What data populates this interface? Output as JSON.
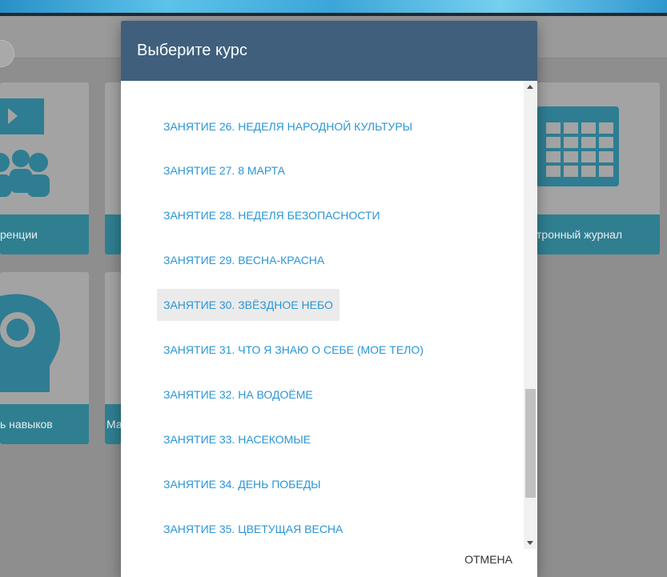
{
  "background_tiles": [
    {
      "label": "ренции"
    },
    {
      "label": ""
    },
    {
      "label": "тронный журнал"
    },
    {
      "label": "ь навыков"
    },
    {
      "label": "Ма"
    }
  ],
  "modal": {
    "title": "Выберите курс",
    "items": [
      {
        "label": "Занятие 26. Неделя народной культуры"
      },
      {
        "label": "Занятие 27. 8 Марта"
      },
      {
        "label": "Занятие 28. Неделя безопасности"
      },
      {
        "label": "Занятие 29. Весна-красна"
      },
      {
        "label": "Занятие 30. Звёздное небо"
      },
      {
        "label": "Занятие 31. Что я знаю о себе (мое тело)"
      },
      {
        "label": "Занятие 32. На водоёме"
      },
      {
        "label": "Занятие 33. Насекомые"
      },
      {
        "label": "Занятие 34. День Победы"
      },
      {
        "label": "Занятие 35. Цветущая весна"
      }
    ],
    "hovered_index": 4,
    "cancel_label": "Отмена"
  },
  "colors": {
    "header": "#3f5f7d",
    "link": "#2a96d6",
    "tile_label_bg": "#2f7f91"
  }
}
